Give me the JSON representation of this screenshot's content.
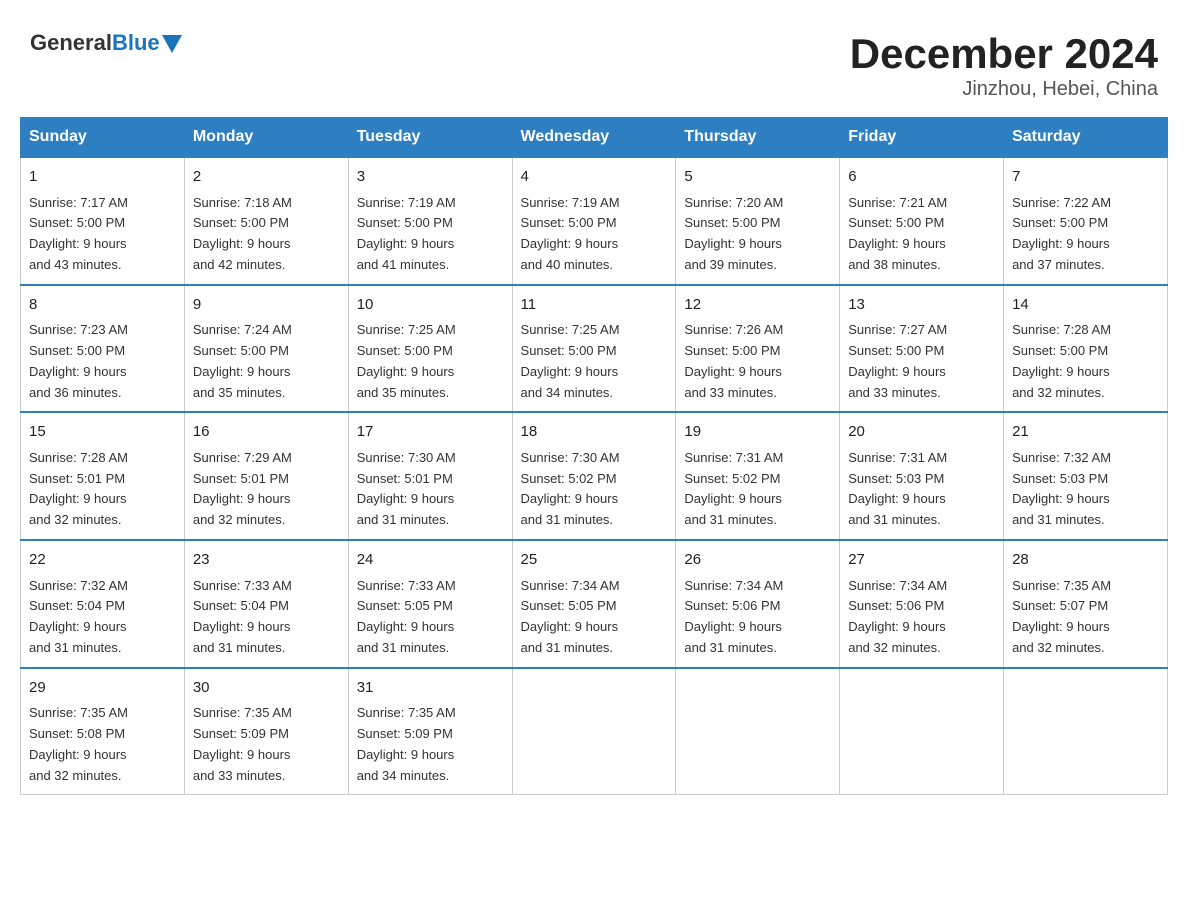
{
  "header": {
    "logo": {
      "general": "General",
      "blue": "Blue"
    },
    "title": "December 2024",
    "location": "Jinzhou, Hebei, China"
  },
  "days_of_week": [
    "Sunday",
    "Monday",
    "Tuesday",
    "Wednesday",
    "Thursday",
    "Friday",
    "Saturday"
  ],
  "weeks": [
    [
      {
        "day": "1",
        "sunrise": "7:17 AM",
        "sunset": "5:00 PM",
        "daylight": "9 hours and 43 minutes."
      },
      {
        "day": "2",
        "sunrise": "7:18 AM",
        "sunset": "5:00 PM",
        "daylight": "9 hours and 42 minutes."
      },
      {
        "day": "3",
        "sunrise": "7:19 AM",
        "sunset": "5:00 PM",
        "daylight": "9 hours and 41 minutes."
      },
      {
        "day": "4",
        "sunrise": "7:19 AM",
        "sunset": "5:00 PM",
        "daylight": "9 hours and 40 minutes."
      },
      {
        "day": "5",
        "sunrise": "7:20 AM",
        "sunset": "5:00 PM",
        "daylight": "9 hours and 39 minutes."
      },
      {
        "day": "6",
        "sunrise": "7:21 AM",
        "sunset": "5:00 PM",
        "daylight": "9 hours and 38 minutes."
      },
      {
        "day": "7",
        "sunrise": "7:22 AM",
        "sunset": "5:00 PM",
        "daylight": "9 hours and 37 minutes."
      }
    ],
    [
      {
        "day": "8",
        "sunrise": "7:23 AM",
        "sunset": "5:00 PM",
        "daylight": "9 hours and 36 minutes."
      },
      {
        "day": "9",
        "sunrise": "7:24 AM",
        "sunset": "5:00 PM",
        "daylight": "9 hours and 35 minutes."
      },
      {
        "day": "10",
        "sunrise": "7:25 AM",
        "sunset": "5:00 PM",
        "daylight": "9 hours and 35 minutes."
      },
      {
        "day": "11",
        "sunrise": "7:25 AM",
        "sunset": "5:00 PM",
        "daylight": "9 hours and 34 minutes."
      },
      {
        "day": "12",
        "sunrise": "7:26 AM",
        "sunset": "5:00 PM",
        "daylight": "9 hours and 33 minutes."
      },
      {
        "day": "13",
        "sunrise": "7:27 AM",
        "sunset": "5:00 PM",
        "daylight": "9 hours and 33 minutes."
      },
      {
        "day": "14",
        "sunrise": "7:28 AM",
        "sunset": "5:00 PM",
        "daylight": "9 hours and 32 minutes."
      }
    ],
    [
      {
        "day": "15",
        "sunrise": "7:28 AM",
        "sunset": "5:01 PM",
        "daylight": "9 hours and 32 minutes."
      },
      {
        "day": "16",
        "sunrise": "7:29 AM",
        "sunset": "5:01 PM",
        "daylight": "9 hours and 32 minutes."
      },
      {
        "day": "17",
        "sunrise": "7:30 AM",
        "sunset": "5:01 PM",
        "daylight": "9 hours and 31 minutes."
      },
      {
        "day": "18",
        "sunrise": "7:30 AM",
        "sunset": "5:02 PM",
        "daylight": "9 hours and 31 minutes."
      },
      {
        "day": "19",
        "sunrise": "7:31 AM",
        "sunset": "5:02 PM",
        "daylight": "9 hours and 31 minutes."
      },
      {
        "day": "20",
        "sunrise": "7:31 AM",
        "sunset": "5:03 PM",
        "daylight": "9 hours and 31 minutes."
      },
      {
        "day": "21",
        "sunrise": "7:32 AM",
        "sunset": "5:03 PM",
        "daylight": "9 hours and 31 minutes."
      }
    ],
    [
      {
        "day": "22",
        "sunrise": "7:32 AM",
        "sunset": "5:04 PM",
        "daylight": "9 hours and 31 minutes."
      },
      {
        "day": "23",
        "sunrise": "7:33 AM",
        "sunset": "5:04 PM",
        "daylight": "9 hours and 31 minutes."
      },
      {
        "day": "24",
        "sunrise": "7:33 AM",
        "sunset": "5:05 PM",
        "daylight": "9 hours and 31 minutes."
      },
      {
        "day": "25",
        "sunrise": "7:34 AM",
        "sunset": "5:05 PM",
        "daylight": "9 hours and 31 minutes."
      },
      {
        "day": "26",
        "sunrise": "7:34 AM",
        "sunset": "5:06 PM",
        "daylight": "9 hours and 31 minutes."
      },
      {
        "day": "27",
        "sunrise": "7:34 AM",
        "sunset": "5:06 PM",
        "daylight": "9 hours and 32 minutes."
      },
      {
        "day": "28",
        "sunrise": "7:35 AM",
        "sunset": "5:07 PM",
        "daylight": "9 hours and 32 minutes."
      }
    ],
    [
      {
        "day": "29",
        "sunrise": "7:35 AM",
        "sunset": "5:08 PM",
        "daylight": "9 hours and 32 minutes."
      },
      {
        "day": "30",
        "sunrise": "7:35 AM",
        "sunset": "5:09 PM",
        "daylight": "9 hours and 33 minutes."
      },
      {
        "day": "31",
        "sunrise": "7:35 AM",
        "sunset": "5:09 PM",
        "daylight": "9 hours and 34 minutes."
      },
      null,
      null,
      null,
      null
    ]
  ]
}
